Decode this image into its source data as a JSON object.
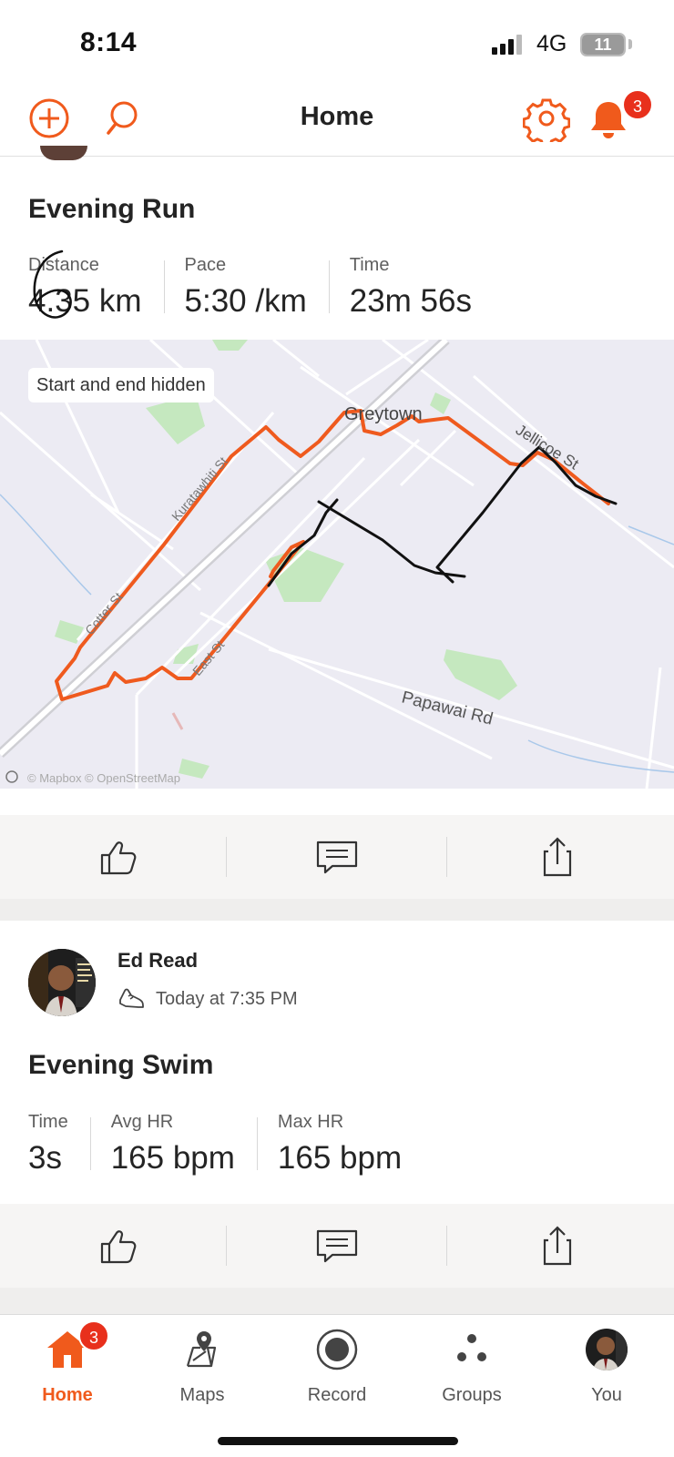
{
  "status_bar": {
    "time": "8:14",
    "network": "4G",
    "battery": "11"
  },
  "header": {
    "title": "Home",
    "notification_count": "3"
  },
  "activity_run": {
    "title": "Evening Run",
    "stats": [
      {
        "label": "Distance",
        "value": "4.35 km"
      },
      {
        "label": "Pace",
        "value": "5:30 /km"
      },
      {
        "label": "Time",
        "value": "23m 56s"
      }
    ],
    "map": {
      "privacy_chip": "Start and end hidden",
      "town_label": "Greytown",
      "road_labels": [
        "Papawai Rd",
        "Jellicoe St"
      ],
      "attribution": "© Mapbox © OpenStreetMap"
    }
  },
  "activity_swim": {
    "athlete": "Ed Read",
    "timestamp": "Today at 7:35 PM",
    "title": "Evening Swim",
    "stats": [
      {
        "label": "Time",
        "value": "3s"
      },
      {
        "label": "Avg HR",
        "value": "165 bpm"
      },
      {
        "label": "Max HR",
        "value": "165 bpm"
      }
    ]
  },
  "tabbar": {
    "items": [
      {
        "label": "Home",
        "active": true,
        "badge": "3"
      },
      {
        "label": "Maps"
      },
      {
        "label": "Record"
      },
      {
        "label": "Groups"
      },
      {
        "label": "You"
      }
    ]
  },
  "colors": {
    "accent": "#f05a1c",
    "badge": "#e8301c",
    "route": "#ef5a1e",
    "map_bg": "#ecebf3",
    "park": "#b9e3b2"
  }
}
